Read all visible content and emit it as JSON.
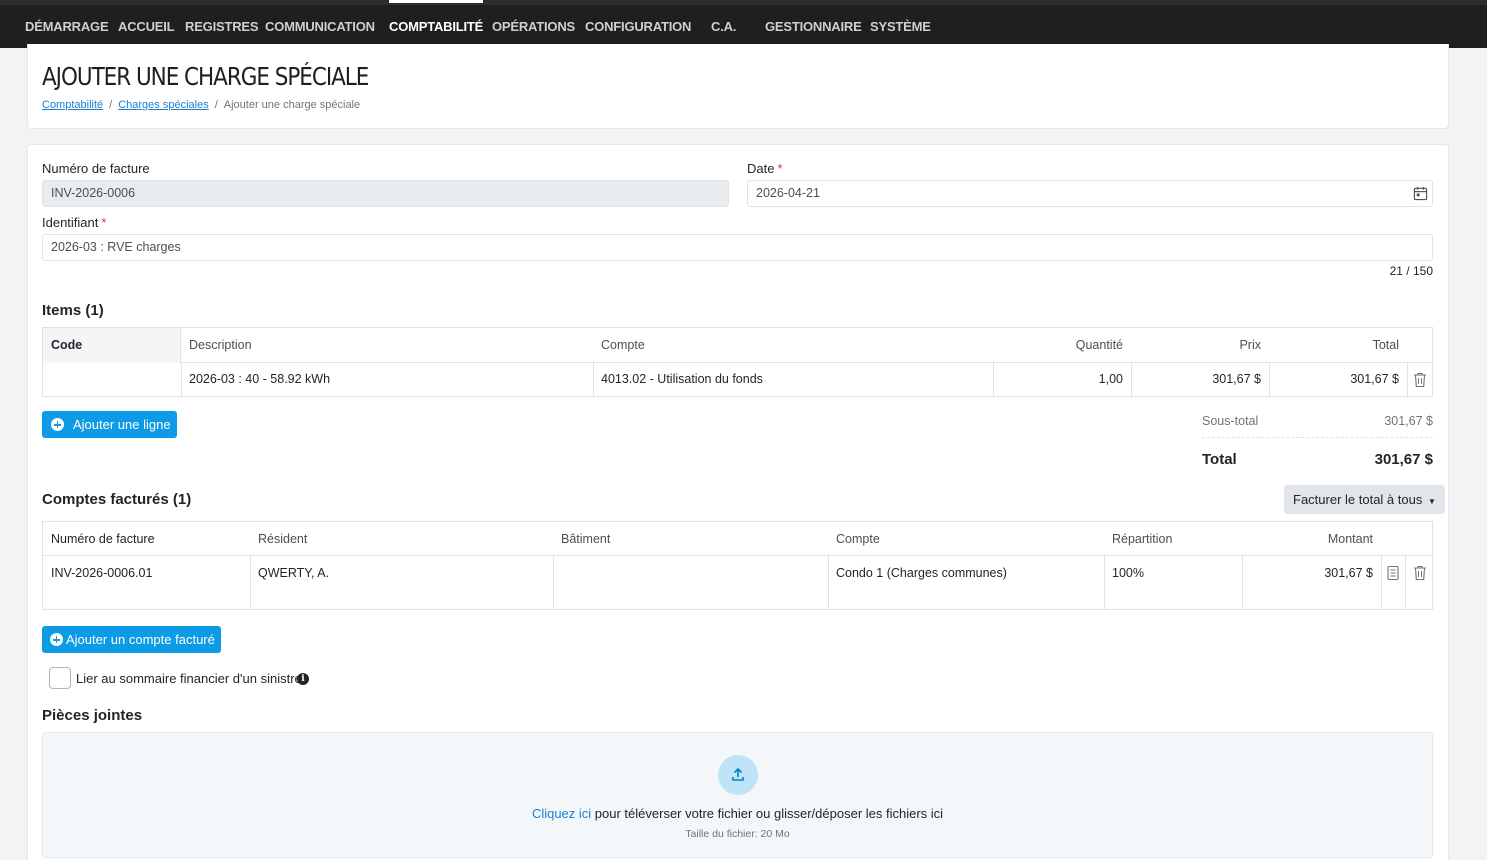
{
  "nav": {
    "items": [
      {
        "label": "DÉMARRAGE"
      },
      {
        "label": "ACCUEIL"
      },
      {
        "label": "REGISTRES"
      },
      {
        "label": "COMMUNICATION"
      },
      {
        "label": "COMPTABILITÉ",
        "active": true
      },
      {
        "label": "OPÉRATIONS"
      },
      {
        "label": "CONFIGURATION"
      },
      {
        "label": "C.A."
      },
      {
        "label": "GESTIONNAIRE"
      },
      {
        "label": "SYSTÈME"
      }
    ]
  },
  "header": {
    "title": "AJOUTER UNE CHARGE SPÉCIALE",
    "breadcrumb": [
      "Comptabilité",
      "Charges spéciales",
      "Ajouter une charge spéciale"
    ],
    "breadcrumb_sep": "/"
  },
  "form": {
    "invoice_number_label": "Numéro de facture",
    "invoice_number_value": "INV-2026-0006",
    "date_label": "Date",
    "date_value": "2026-04-21",
    "identifier_label": "Identifiant",
    "identifier_value": "2026-03 : RVE charges",
    "identifier_counter": "21 / 150",
    "required_mark": "*"
  },
  "items": {
    "title": "Items (1)",
    "columns": [
      "Code",
      "Description",
      "Compte",
      "Quantité",
      "Prix",
      "Total"
    ],
    "rows": [
      {
        "code": "",
        "description": "2026-03 : 40 - 58.92 kWh",
        "compte": "4013.02 - Utilisation du fonds",
        "quantite": "1,00",
        "prix": "301,67 $",
        "total": "301,67 $"
      }
    ],
    "add_line_label": "Ajouter une ligne",
    "subtotal_label": "Sous-total",
    "subtotal_value": "301,67 $",
    "total_label": "Total",
    "total_value": "301,67 $"
  },
  "billed": {
    "title": "Comptes facturés (1)",
    "bill_all_label": "Facturer le total à tous",
    "columns": [
      "Numéro de facture",
      "Résident",
      "Bâtiment",
      "Compte",
      "Répartition",
      "Montant"
    ],
    "rows": [
      {
        "invoice": "INV-2026-0006.01",
        "resident": "QWERTY, A.",
        "batiment": "",
        "compte": "Condo 1 (Charges communes)",
        "repartition": "100%",
        "montant": "301,67 $"
      }
    ],
    "add_account_label": "Ajouter un compte facturé",
    "link_claim_label": "Lier au sommaire financier d'un sinistre"
  },
  "attachments": {
    "title": "Pièces jointes",
    "click_here": "Cliquez ici",
    "drop_text": " pour téléverser votre fichier ou glisser/déposer les fichiers ici",
    "size_note": "Taille du fichier: 20 Mo"
  },
  "colors": {
    "primary": "#0d9be6",
    "nav_bg": "#1f1f1f",
    "required": "#dc3545",
    "link": "#1a7fd1"
  },
  "icons": [
    "calendar-icon",
    "plus-circle-icon",
    "trash-icon",
    "document-icon",
    "info-icon",
    "upload-icon",
    "caret-down-icon"
  ]
}
